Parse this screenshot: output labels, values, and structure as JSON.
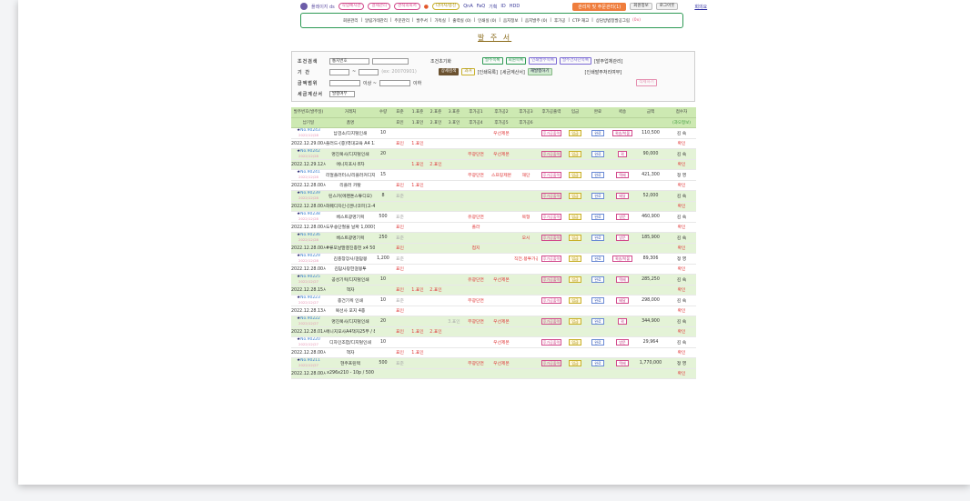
{
  "topbar": {
    "brand": "플레이지 ds",
    "chips": [
      "작업예시관",
      "결제관리",
      "견적의뢰서"
    ],
    "pill": "더이지/용신",
    "links": [
      "QnA",
      "FaQ",
      "기획",
      "ID",
      "HDD"
    ],
    "alert": "관리자 및 주문관리(1)",
    "btn1": "회원정보",
    "btn2": "로그아웃",
    "right": "회의요"
  },
  "menu": {
    "items": [
      "회원관리",
      "알림가테관리",
      "주문관리",
      "발주서",
      "가독실",
      "출력실 (0)",
      "인쇄실 (0)",
      "음지정보",
      "음지발주 (0)",
      "후가공",
      "CTP 재고",
      "상담방법정발공그림"
    ],
    "current_suffix": "(0x)"
  },
  "title": "발 주 서",
  "search": {
    "label_cond": "조건검색",
    "sel_cond": "통지번호",
    "reset": "조건초기화",
    "label_period": "기 간",
    "to": "~",
    "days_note": "(ex: 20070901)",
    "label_amount": "금액범위",
    "label_settle": "세금계산서",
    "sel_settle": "발행여부",
    "range_hint": "이상 ~",
    "range_hint2": "이하",
    "btns_row1": [
      "발주목록",
      "회원목록",
      "인쇄발주목록",
      "발주건차단목록"
    ],
    "extra1": "[발주업체관리]",
    "btns_row2": [
      "상세검색",
      "과거"
    ],
    "extra2": "[인쇄목록]",
    "extra3": "[세금계산서]",
    "btn_issue": "재발행하기",
    "extra4": "[인쇄발주처리여부]",
    "pink_btn": "삭제하기"
  },
  "table": {
    "headers1": [
      "발주번호(발주일)",
      "거래처",
      "수량",
      "표준",
      "1.표준",
      "2.표준",
      "3.표준",
      "후가공1",
      "후가공2",
      "후가공3",
      "후가공출력",
      "입금",
      "완료",
      "퀵송",
      "금액",
      "접수자"
    ],
    "headers2": [
      "납기일",
      "품명",
      "",
      "표인",
      "1.표인",
      "2.표인",
      "3.표인",
      "후가공4",
      "후가공5",
      "후가공6",
      "",
      "",
      "",
      "",
      "",
      "(과오정보)"
    ],
    "rows": [
      {
        "no": "No.90243",
        "d1": "2022/12/28",
        "due": "2022.12.29.00시",
        "client": "납검소/디지털인쇄",
        "item": "플러드-(증)역대교육 A4 13장 ~ 전부단면첨컬",
        "qty": "10",
        "std": "",
        "std2": "표인",
        "s1": "",
        "s1b": "1.표인",
        "s2": "",
        "s3": "",
        "p1": "",
        "p2": "우선제본",
        "p3": "",
        "p4": "",
        "out": "후가공출력",
        "pay": "입금",
        "done": "완료",
        "quick": "퀵송/착불",
        "amt": "110,500",
        "rec": "김 숙",
        "conf": "확인",
        "alt": false
      },
      {
        "no": "No.90242",
        "d1": "2022/12/28",
        "due": "2022.12.29.12시",
        "client": "명진복사/디지털인쇄",
        "item": "에니지포사 8차",
        "qty": "20",
        "std": "",
        "std2": "",
        "s1": "",
        "s1b": "1.표인",
        "s2": "",
        "s2b": "2.표인",
        "s3": "",
        "p1": "무광단면",
        "p2": "우선제본",
        "p3": "",
        "p4": "",
        "out": "후가공출력",
        "pay": "입금",
        "done": "완료",
        "quick": "퀵",
        "amt": "90,000",
        "rec": "김 숙",
        "conf": "확인",
        "alt": true
      },
      {
        "no": "No.90241",
        "d1": "2022/12/28",
        "due": "2022.12.28.00시",
        "client": "리얼플러터스/리플러커디지털인쇄",
        "item": "리플러 카탈",
        "qty": "15",
        "std": "",
        "std2": "표인",
        "s1": "",
        "s1b": "1.표인",
        "s2": "",
        "s3": "",
        "p1": "무광단면",
        "p2": "스프링제본",
        "p3": "재단",
        "p4": "",
        "out": "후가공출력",
        "pay": "입금",
        "done": "완료",
        "quick": "택배",
        "amt": "421,300",
        "rec": "정 영",
        "conf": "확인",
        "alt": false
      },
      {
        "no": "No.90239",
        "d1": "2022/12/28",
        "due": "2022.12.28.00시",
        "client": "린스카(에펜톤스튜디오)",
        "item": "화훼디자인-[앤나코피)고-4면",
        "qty": "8",
        "std": "표준",
        "std2": "",
        "s1": "",
        "s1b": "",
        "s2": "",
        "s3": "",
        "p1": "",
        "p2": "",
        "p3": "",
        "p4": "",
        "out": "후가공출력",
        "pay": "입금",
        "done": "완료",
        "quick": "배달",
        "amt": "52,000",
        "rec": "김 숙",
        "conf": "확인",
        "alt": true
      },
      {
        "no": "No.90238",
        "d1": "2022/12/28",
        "due": "2022.12.28.00시",
        "client": "베스트광명기획",
        "item": "도우송단절불 날짜 1,000장",
        "qty": "500",
        "std": "표준",
        "std2": "표인",
        "s1": "",
        "s1b": "",
        "s2": "",
        "s3": "",
        "p1": "유광단면",
        "p1b": "폴라",
        "p2": "",
        "p3": "목형",
        "p4": "",
        "out": "후가공출력",
        "pay": "입금",
        "done": "완료",
        "quick": "방문",
        "amt": "460,900",
        "rec": "김 숙",
        "conf": "확인",
        "alt": false
      },
      {
        "no": "No.90236",
        "d1": "2022/12/28",
        "due": "2022.12.28.00시",
        "client": "베스트광명기획",
        "item": "#류포날말결진종헌 x4 500개 == 명진지",
        "qty": "250",
        "std": "표준",
        "std2": "표인",
        "s1": "",
        "s1b": "",
        "s2": "",
        "s3": "",
        "p1": "",
        "p1b": "접지",
        "p2": "",
        "p3": "오시",
        "p4": "",
        "out": "후가공출력",
        "pay": "입금",
        "done": "완료",
        "quick": "방문",
        "amt": "185,900",
        "rec": "김 숙",
        "conf": "확인",
        "alt": true
      },
      {
        "no": "No.90229",
        "d1": "2022/12/28",
        "due": "2022.12.28.00시",
        "client": "김충창장사/걸답봉",
        "item": "김답사랑한걸봉투",
        "qty": "1,200",
        "std": "표준",
        "std2": "표인",
        "s1": "",
        "s1b": "",
        "s2": "",
        "s3": "",
        "p1": "",
        "p2": "",
        "p3": "직전.봉투가공",
        "p4": "",
        "out": "후가공출력",
        "pay": "입금",
        "done": "완료",
        "quick": "퀵송/착불",
        "amt": "89,306",
        "rec": "정 영",
        "conf": "확인",
        "alt": false
      },
      {
        "no": "No.90225",
        "d1": "2022/12/27",
        "due": "2022.12.28.15시",
        "client": "공성기획/디지털인쇄",
        "item": "책자",
        "qty": "10",
        "std": "",
        "std2": "표인",
        "s1": "",
        "s1b": "1.표인",
        "s2": "",
        "s2b": "2.표인",
        "s3": "",
        "p1": "유광단면",
        "p2": "우선제본",
        "p3": "",
        "p4": "",
        "out": "후가공출력",
        "pay": "입금",
        "done": "완료",
        "quick": "택배",
        "amt": "285,250",
        "rec": "김 숙",
        "conf": "확인",
        "alt": true
      },
      {
        "no": "No.90223",
        "d1": "2022/12/27",
        "due": "2022.12.28.13시",
        "client": "종건기획 인쇄",
        "item": "복선사 포지 4종",
        "qty": "10",
        "std": "표준",
        "std2": "표인",
        "s1": "",
        "s1b": "",
        "s2": "",
        "s3": "",
        "p1": "무광단면",
        "p2": "",
        "p3": "",
        "p4": "",
        "out": "후가공출력",
        "pay": "입금",
        "done": "완료",
        "quick": "배달",
        "amt": "298,000",
        "rec": "김 숙",
        "conf": "확인",
        "alt": false
      },
      {
        "no": "No.90222",
        "d1": "2022/12/27",
        "due": "2022.12.28.01시",
        "client": "명진복사/디지털인쇄",
        "item": "에니지포사A4책자25부 / 8페지자24부",
        "qty": "20",
        "std": "",
        "std2": "표인",
        "s1": "",
        "s1b": "1.표인",
        "s2": "",
        "s2b": "2.표인",
        "s3": "3.표인",
        "p1": "무광단면",
        "p2": "우선제본",
        "p3": "",
        "p4": "",
        "out": "후가공출력",
        "pay": "입금",
        "done": "완료",
        "quick": "퀵",
        "amt": "344,900",
        "rec": "김 숙",
        "conf": "확인",
        "alt": true
      },
      {
        "no": "No.90220",
        "d1": "2022/12/27",
        "due": "2022.12.28.00시",
        "client": "디자인조합/디지털인쇄",
        "item": "책자",
        "qty": "10",
        "std": "",
        "std2": "표인",
        "s1": "",
        "s1b": "1.표인",
        "s2": "",
        "s3": "",
        "p1": "",
        "p2": "우선제본",
        "p3": "",
        "p4": "",
        "out": "후가공출력",
        "pay": "입금",
        "done": "완료",
        "quick": "방문",
        "amt": "29,964",
        "rec": "김 숙",
        "conf": "확인",
        "alt": false
      },
      {
        "no": "No.90211",
        "d1": "2022/12/27",
        "due": "2022.12.28.00시",
        "client": "현주프린텍",
        "item": "x296x210 - 10p / 500",
        "qty": "500",
        "std": "표준",
        "std2": "",
        "s1": "",
        "s1b": "",
        "s2": "",
        "s3": "",
        "p1": "무광단면",
        "p2": "우선제본",
        "p3": "",
        "p4": "",
        "out": "후가공출력",
        "pay": "입금",
        "done": "완료",
        "quick": "택배",
        "amt": "1,770,000",
        "rec": "정 영",
        "conf": "확인",
        "alt": true
      }
    ]
  }
}
